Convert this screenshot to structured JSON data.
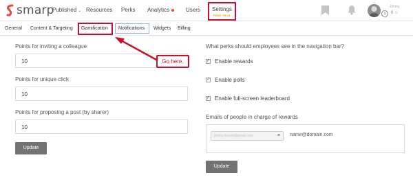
{
  "header": {
    "logo_text": "smarp",
    "nav": [
      {
        "label": "Published",
        "has_chevron": true
      },
      {
        "label": "Resources"
      },
      {
        "label": "Perks"
      },
      {
        "label": "Analytics",
        "has_dot": true
      },
      {
        "label": "Users"
      }
    ],
    "settings_label": "Settings",
    "trial_label": "FREE TRIAL",
    "user_name": "Jimmy",
    "notification_count": "1",
    "stars": "0 ☆",
    "icons": [
      "bookmark-icon",
      "bell-icon"
    ]
  },
  "subnav": {
    "items": [
      "General",
      "Content & Targeting",
      "Gamification",
      "Notifications",
      "Widgets",
      "Billing"
    ]
  },
  "left": {
    "fields": [
      {
        "label": "Points for inviting a colleague",
        "value": "10"
      },
      {
        "label": "Points for unique click",
        "value": "10"
      },
      {
        "label": "Points for proposing a post (by sharer)",
        "value": "10"
      }
    ],
    "update_label": "Update"
  },
  "annotation": {
    "text": "Go here."
  },
  "right": {
    "question": "What perks should employees see in the navigation bar?",
    "checks": [
      {
        "label": "Enable rewards",
        "checked": true
      },
      {
        "label": "Enable polls",
        "checked": true
      },
      {
        "label": "Enable full-screen leaderboard",
        "checked": true
      }
    ],
    "emails_label": "Emails of people in charge of rewards",
    "email_tag": "jimmy.doucet@gmail.com",
    "email_placeholder": "name@domain.com",
    "update_label": "Update"
  },
  "colors": {
    "highlight": "#c8102e",
    "button": "#727272",
    "trial": "#e8a000",
    "analytics_dot": "#e8463b"
  }
}
